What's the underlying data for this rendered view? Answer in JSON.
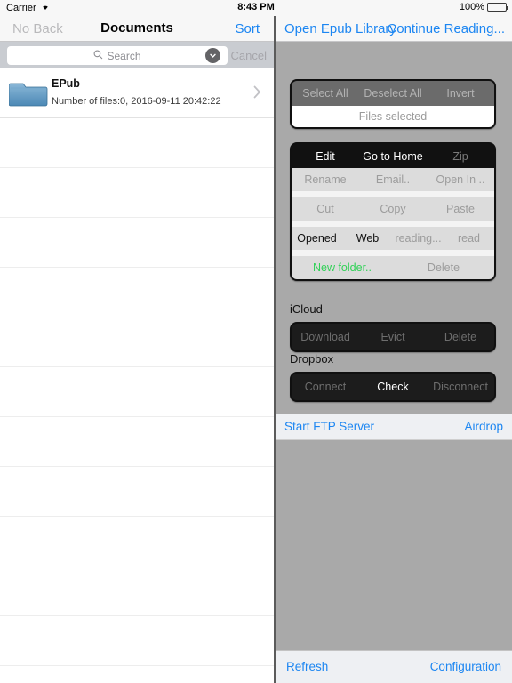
{
  "status_bar": {
    "carrier": "Carrier",
    "wifi_icon": "wifi-icon",
    "time": "8:43 PM",
    "battery_percent": "100%",
    "battery_icon": "battery-full-icon"
  },
  "left_pane": {
    "navbar": {
      "back_label": "No Back",
      "title": "Documents",
      "sort_label": "Sort"
    },
    "search": {
      "placeholder": "Search",
      "value": "",
      "search_icon": "search-icon",
      "dropdown_icon": "chevron-down-circle-icon",
      "cancel_label": "Cancel"
    },
    "list": {
      "rows": [
        {
          "icon": "folder-icon",
          "title": "EPub",
          "subtitle": "Number of files:0,   2016-09-11 20:42:22",
          "accessory": "chevron-right-icon"
        }
      ],
      "empty_row_count": 11
    }
  },
  "right_pane": {
    "navbar": {
      "open_library_label": "Open Epub Library",
      "continue_reading_label": "Continue Reading..."
    },
    "selection_panel": {
      "select_all_label": "Select All",
      "deselect_all_label": "Deselect All",
      "invert_label": "Invert",
      "status_label": "Files selected"
    },
    "actions_panel": {
      "row1": {
        "edit_label": "Edit",
        "go_home_label": "Go to Home",
        "zip_label": "Zip"
      },
      "row2": {
        "rename_label": "Rename",
        "email_label": "Email..",
        "open_in_label": "Open In .."
      },
      "row3": {
        "cut_label": "Cut",
        "copy_label": "Copy",
        "paste_label": "Paste"
      },
      "row4": {
        "opened_label": "Opened",
        "web_label": "Web",
        "reading_label": "reading...",
        "read_label": "read"
      },
      "row5": {
        "new_folder_label": "New folder..",
        "delete_label": "Delete"
      }
    },
    "icloud": {
      "section_label": "iCloud",
      "download_label": "Download",
      "evict_label": "Evict",
      "delete_label": "Delete"
    },
    "dropbox": {
      "section_label": "Dropbox",
      "connect_label": "Connect",
      "check_label": "Check",
      "disconnect_label": "Disconnect"
    },
    "ftp_bar": {
      "start_ftp_label": "Start FTP Server",
      "airdrop_label": "Airdrop"
    },
    "bottom_bar": {
      "refresh_label": "Refresh",
      "configuration_label": "Configuration"
    }
  },
  "colors": {
    "accent_blue": "#1c86f2",
    "green": "#31d157",
    "pane_bg": "#a9a9a9",
    "panel_black": "#111111"
  }
}
